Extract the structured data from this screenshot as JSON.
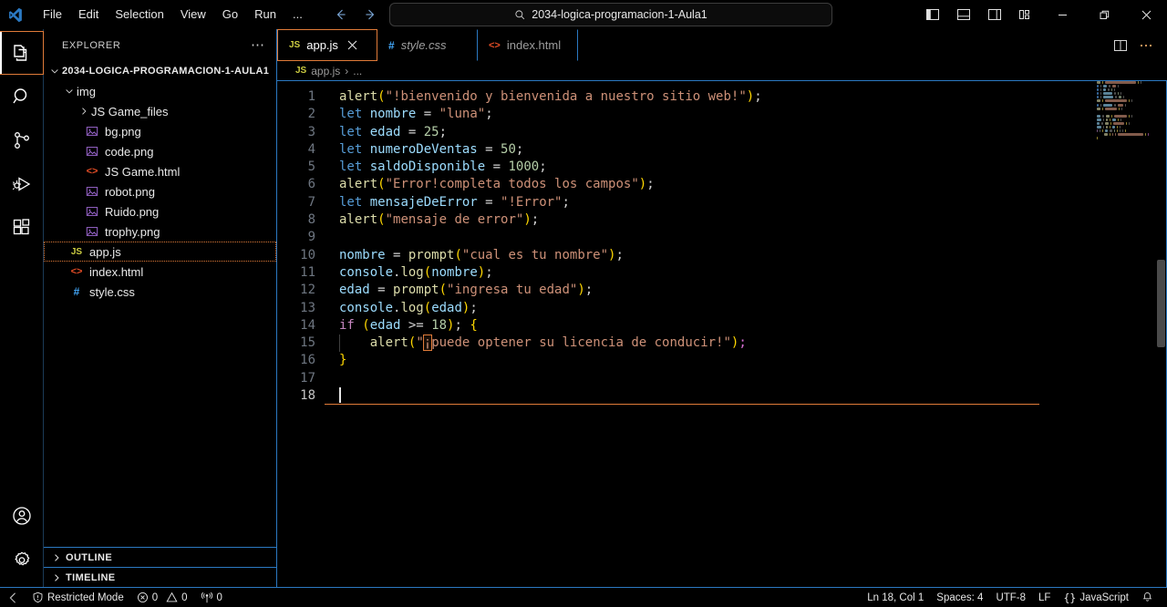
{
  "titlebar": {
    "logo_icon": "vscode-logo-icon",
    "menu": [
      {
        "label": "File"
      },
      {
        "label": "Edit"
      },
      {
        "label": "Selection"
      },
      {
        "label": "View"
      },
      {
        "label": "Go"
      },
      {
        "label": "Run"
      },
      {
        "label": "..."
      }
    ],
    "nav_back_icon": "arrow-left-icon",
    "nav_forward_icon": "arrow-right-icon",
    "search": {
      "value": "2034-logica-programacion-1-Aula1",
      "placeholder": "Search",
      "icon": "search-icon"
    },
    "layout_controls": [
      {
        "name": "toggle-primary-sidebar-icon"
      },
      {
        "name": "toggle-panel-icon"
      },
      {
        "name": "toggle-secondary-sidebar-icon"
      },
      {
        "name": "customize-layout-icon"
      }
    ],
    "window_controls": [
      {
        "name": "minimize-button",
        "glyph": "─"
      },
      {
        "name": "restore-button",
        "glyph": "❐"
      },
      {
        "name": "close-button",
        "glyph": "✕"
      }
    ]
  },
  "activitybar": {
    "items": [
      {
        "name": "explorer",
        "icon": "files-icon",
        "active": true
      },
      {
        "name": "search",
        "icon": "search-icon",
        "active": false
      },
      {
        "name": "source-control",
        "icon": "source-control-icon",
        "active": false
      },
      {
        "name": "run-and-debug",
        "icon": "run-debug-icon",
        "active": false
      },
      {
        "name": "extensions",
        "icon": "extensions-icon",
        "active": false
      }
    ],
    "bottom_items": [
      {
        "name": "accounts",
        "icon": "account-icon"
      },
      {
        "name": "manage",
        "icon": "gear-icon"
      }
    ]
  },
  "sidebar": {
    "title": "EXPLORER",
    "more_actions_icon": "ellipsis-icon",
    "root": {
      "label": "2034-LOGICA-PROGRAMACION-1-AULA1",
      "expanded": true
    },
    "tree": [
      {
        "label": "img",
        "type": "folder",
        "expanded": true,
        "depth": 1,
        "icon": "chevron-down-icon"
      },
      {
        "label": "JS Game_files",
        "type": "folder",
        "expanded": false,
        "depth": 2,
        "icon": "chevron-right-icon"
      },
      {
        "label": "bg.png",
        "type": "image",
        "depth": 2,
        "icon": "image-file-icon"
      },
      {
        "label": "code.png",
        "type": "image",
        "depth": 2,
        "icon": "image-file-icon"
      },
      {
        "label": "JS Game.html",
        "type": "html",
        "depth": 2,
        "icon": "html-file-icon"
      },
      {
        "label": "robot.png",
        "type": "image",
        "depth": 2,
        "icon": "image-file-icon"
      },
      {
        "label": "Ruido.png",
        "type": "image",
        "depth": 2,
        "icon": "image-file-icon"
      },
      {
        "label": "trophy.png",
        "type": "image",
        "depth": 2,
        "icon": "image-file-icon"
      },
      {
        "label": "app.js",
        "type": "js",
        "depth": 1,
        "icon": "js-file-icon",
        "selected": true
      },
      {
        "label": "index.html",
        "type": "html",
        "depth": 1,
        "icon": "html-file-icon"
      },
      {
        "label": "style.css",
        "type": "css",
        "depth": 1,
        "icon": "css-file-icon"
      }
    ],
    "sections": [
      {
        "label": "OUTLINE",
        "expanded": false,
        "icon": "chevron-right-icon"
      },
      {
        "label": "TIMELINE",
        "expanded": false,
        "icon": "chevron-right-icon"
      }
    ]
  },
  "tabs": {
    "items": [
      {
        "label": "app.js",
        "type": "js",
        "active": true,
        "preview": false,
        "close_icon": "close-icon"
      },
      {
        "label": "style.css",
        "type": "css",
        "active": false,
        "preview": true
      },
      {
        "label": "index.html",
        "type": "html",
        "active": false,
        "preview": false
      }
    ],
    "actions": [
      {
        "name": "split-editor-right-icon"
      },
      {
        "name": "more-actions-icon"
      }
    ]
  },
  "breadcrumbs": {
    "icon": "js-file-icon",
    "file": "app.js",
    "separator": "›",
    "trailing": "..."
  },
  "editor": {
    "language": "JavaScript",
    "lines": [
      {
        "n": 1,
        "tokens": [
          {
            "t": "alert",
            "c": "fn"
          },
          {
            "t": "(",
            "c": "b1"
          },
          {
            "t": "\"!bienvenido y bienvenida a nuestro sitio web!\"",
            "c": "s"
          },
          {
            "t": ")",
            "c": "b1"
          },
          {
            "t": ";",
            "c": "p"
          }
        ]
      },
      {
        "n": 2,
        "tokens": [
          {
            "t": "let",
            "c": "k"
          },
          {
            "t": " ",
            "c": "p"
          },
          {
            "t": "nombre",
            "c": "v"
          },
          {
            "t": " = ",
            "c": "op"
          },
          {
            "t": "\"luna\"",
            "c": "s"
          },
          {
            "t": ";",
            "c": "p"
          }
        ]
      },
      {
        "n": 3,
        "tokens": [
          {
            "t": "let",
            "c": "k"
          },
          {
            "t": " ",
            "c": "p"
          },
          {
            "t": "edad",
            "c": "v"
          },
          {
            "t": " = ",
            "c": "op"
          },
          {
            "t": "25",
            "c": "n"
          },
          {
            "t": ";",
            "c": "p"
          }
        ]
      },
      {
        "n": 4,
        "tokens": [
          {
            "t": "let",
            "c": "k"
          },
          {
            "t": " ",
            "c": "p"
          },
          {
            "t": "numeroDeVentas",
            "c": "v"
          },
          {
            "t": " = ",
            "c": "op"
          },
          {
            "t": "50",
            "c": "n"
          },
          {
            "t": ";",
            "c": "p"
          }
        ]
      },
      {
        "n": 5,
        "tokens": [
          {
            "t": "let",
            "c": "k"
          },
          {
            "t": " ",
            "c": "p"
          },
          {
            "t": "saldoDisponible",
            "c": "v"
          },
          {
            "t": " = ",
            "c": "op"
          },
          {
            "t": "1000",
            "c": "n"
          },
          {
            "t": ";",
            "c": "p"
          }
        ]
      },
      {
        "n": 6,
        "tokens": [
          {
            "t": "alert",
            "c": "fn"
          },
          {
            "t": "(",
            "c": "b1"
          },
          {
            "t": "\"Error!completa todos los campos\"",
            "c": "s"
          },
          {
            "t": ")",
            "c": "b1"
          },
          {
            "t": ";",
            "c": "p"
          }
        ]
      },
      {
        "n": 7,
        "tokens": [
          {
            "t": "let",
            "c": "k"
          },
          {
            "t": " ",
            "c": "p"
          },
          {
            "t": "mensajeDeError",
            "c": "v"
          },
          {
            "t": " = ",
            "c": "op"
          },
          {
            "t": "\"!Error\"",
            "c": "s"
          },
          {
            "t": ";",
            "c": "p"
          }
        ]
      },
      {
        "n": 8,
        "tokens": [
          {
            "t": "alert",
            "c": "fn"
          },
          {
            "t": "(",
            "c": "b1"
          },
          {
            "t": "\"mensaje de error\"",
            "c": "s"
          },
          {
            "t": ")",
            "c": "b1"
          },
          {
            "t": ";",
            "c": "p"
          }
        ]
      },
      {
        "n": 9,
        "tokens": []
      },
      {
        "n": 10,
        "tokens": [
          {
            "t": "nombre",
            "c": "v"
          },
          {
            "t": " = ",
            "c": "op"
          },
          {
            "t": "prompt",
            "c": "fn"
          },
          {
            "t": "(",
            "c": "b1"
          },
          {
            "t": "\"cual es tu nombre\"",
            "c": "s"
          },
          {
            "t": ")",
            "c": "b1"
          },
          {
            "t": ";",
            "c": "p"
          }
        ]
      },
      {
        "n": 11,
        "tokens": [
          {
            "t": "console",
            "c": "v"
          },
          {
            "t": ".",
            "c": "p"
          },
          {
            "t": "log",
            "c": "fn"
          },
          {
            "t": "(",
            "c": "b1"
          },
          {
            "t": "nombre",
            "c": "v"
          },
          {
            "t": ")",
            "c": "b1"
          },
          {
            "t": ";",
            "c": "p"
          }
        ]
      },
      {
        "n": 12,
        "tokens": [
          {
            "t": "edad",
            "c": "v"
          },
          {
            "t": " = ",
            "c": "op"
          },
          {
            "t": "prompt",
            "c": "fn"
          },
          {
            "t": "(",
            "c": "b1"
          },
          {
            "t": "\"ingresa tu edad\"",
            "c": "s"
          },
          {
            "t": ")",
            "c": "b1"
          },
          {
            "t": ";",
            "c": "p"
          }
        ]
      },
      {
        "n": 13,
        "tokens": [
          {
            "t": "console",
            "c": "v"
          },
          {
            "t": ".",
            "c": "p"
          },
          {
            "t": "log",
            "c": "fn"
          },
          {
            "t": "(",
            "c": "b1"
          },
          {
            "t": "edad",
            "c": "v"
          },
          {
            "t": ")",
            "c": "b1"
          },
          {
            "t": ";",
            "c": "p"
          }
        ]
      },
      {
        "n": 14,
        "tokens": [
          {
            "t": "if",
            "c": "kw"
          },
          {
            "t": " ",
            "c": "p"
          },
          {
            "t": "(",
            "c": "b1"
          },
          {
            "t": "edad",
            "c": "v"
          },
          {
            "t": " >= ",
            "c": "op"
          },
          {
            "t": "18",
            "c": "n"
          },
          {
            "t": ")",
            "c": "b1"
          },
          {
            "t": ";",
            "c": "p"
          },
          {
            "t": " ",
            "c": "p"
          },
          {
            "t": "{",
            "c": "b1"
          }
        ]
      },
      {
        "n": 15,
        "indent": 1,
        "tokens": [
          {
            "t": "alert",
            "c": "fn"
          },
          {
            "t": "(",
            "c": "b1"
          },
          {
            "t": "\"",
            "c": "s"
          },
          {
            "t": "¡",
            "c": "s boxchar"
          },
          {
            "t": "puede optener su licencia de conducir!\"",
            "c": "s"
          },
          {
            "t": ")",
            "c": "b1"
          },
          {
            "t": ";",
            "c": "b2"
          }
        ]
      },
      {
        "n": 16,
        "tokens": [
          {
            "t": "}",
            "c": "b1"
          }
        ]
      },
      {
        "n": 17,
        "tokens": []
      },
      {
        "n": 18,
        "tokens": [],
        "current": true,
        "caret": true
      }
    ],
    "minimap_enabled": true
  },
  "statusbar": {
    "left": [
      {
        "name": "remote-indicator",
        "label": "",
        "icon": "remote-icon"
      },
      {
        "name": "restricted-mode",
        "label": "Restricted Mode",
        "icon": "shield-icon"
      },
      {
        "name": "problems-errors",
        "label": "0",
        "icon": "error-icon"
      },
      {
        "name": "problems-warnings",
        "label": "0",
        "icon": "warning-icon"
      },
      {
        "name": "ports",
        "label": "0",
        "icon": "radio-tower-icon"
      }
    ],
    "right": [
      {
        "name": "cursor-position",
        "label": "Ln 18, Col 1"
      },
      {
        "name": "indentation",
        "label": "Spaces: 4"
      },
      {
        "name": "encoding",
        "label": "UTF-8"
      },
      {
        "name": "eol",
        "label": "LF"
      },
      {
        "name": "language-mode",
        "label": "JavaScript",
        "icon": "braces-icon"
      },
      {
        "name": "notifications",
        "label": "",
        "icon": "bell-icon"
      }
    ]
  },
  "colors": {
    "background": "#000000",
    "accent_border": "#2b79c2",
    "focus_border": "#e07b39",
    "keyword": "#569cd6",
    "control_keyword": "#c586c0",
    "function": "#dcdcaa",
    "variable": "#9cdcfe",
    "string": "#ce9178",
    "number": "#b5cea8",
    "bracket1": "#ffd700",
    "bracket2": "#da70d6",
    "line_number": "#6e7681"
  }
}
